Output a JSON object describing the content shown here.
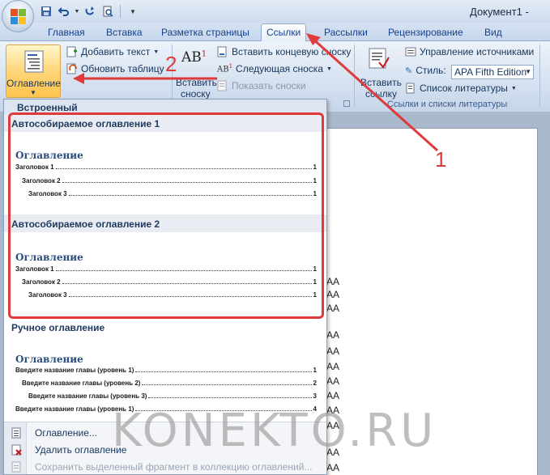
{
  "window": {
    "title": "Документ1 -"
  },
  "tabs": [
    {
      "label": "Главная",
      "active": false
    },
    {
      "label": "Вставка",
      "active": false
    },
    {
      "label": "Разметка страницы",
      "active": false
    },
    {
      "label": "Ссылки",
      "active": true
    },
    {
      "label": "Рассылки",
      "active": false
    },
    {
      "label": "Рецензирование",
      "active": false
    },
    {
      "label": "Вид",
      "active": false
    }
  ],
  "ribbon": {
    "toc_button": "Оглавление",
    "add_text": "Добавить текст",
    "update_table": "Обновить таблицу",
    "insert_footnote": [
      "Вставить",
      "сноску"
    ],
    "insert_endnote": "Вставить концевую сноску",
    "next_footnote": "Следующая сноска",
    "show_notes": "Показать сноски",
    "insert_citation": [
      "Вставить",
      "ссылку"
    ],
    "manage_sources": "Управление источниками",
    "style_label": "Стиль:",
    "style_value": "APA Fifth Edition",
    "bibliography": "Список литературы",
    "group_citations": "Ссылки и списки литературы",
    "ab_icon": "AB"
  },
  "gallery": {
    "header": "Встроенный",
    "auto1": {
      "title": "Автособираемое оглавление 1",
      "toc_head": "Оглавление",
      "lines": [
        {
          "text": "Заголовок 1",
          "page": "1"
        },
        {
          "text": "Заголовок 2",
          "page": "1"
        },
        {
          "text": "Заголовок 3",
          "page": "1"
        }
      ]
    },
    "auto2": {
      "title": "Автособираемое оглавление 2",
      "toc_head": "Оглавление",
      "lines": [
        {
          "text": "Заголовок 1",
          "page": "1"
        },
        {
          "text": "Заголовок 2",
          "page": "1"
        },
        {
          "text": "Заголовок 3",
          "page": "1"
        }
      ]
    },
    "manual": {
      "title": "Ручное оглавление",
      "toc_head": "Оглавление",
      "lines": [
        {
          "text": "Введите название главы (уровень 1)",
          "page": "1"
        },
        {
          "text": "Введите название главы (уровень 2)",
          "page": "2"
        },
        {
          "text": "Введите название главы (уровень 3)",
          "page": "3"
        },
        {
          "text": "Введите название главы (уровень 1)",
          "page": "4"
        }
      ]
    },
    "menu": {
      "toc": "Оглавление...",
      "remove": "Удалить оглавление",
      "save": "Сохранить выделенный фрагмент в коллекцию оглавлений..."
    }
  },
  "document": {
    "aa": [
      "АА",
      "АА",
      "АА",
      "АА",
      "АА",
      "АА",
      "АА",
      "АА",
      "АА",
      "АА",
      "АА",
      "АА"
    ]
  },
  "annotations": {
    "n1": "1",
    "n2": "2",
    "color": "#e03a3a"
  },
  "watermark": "KONEKTO.RU"
}
